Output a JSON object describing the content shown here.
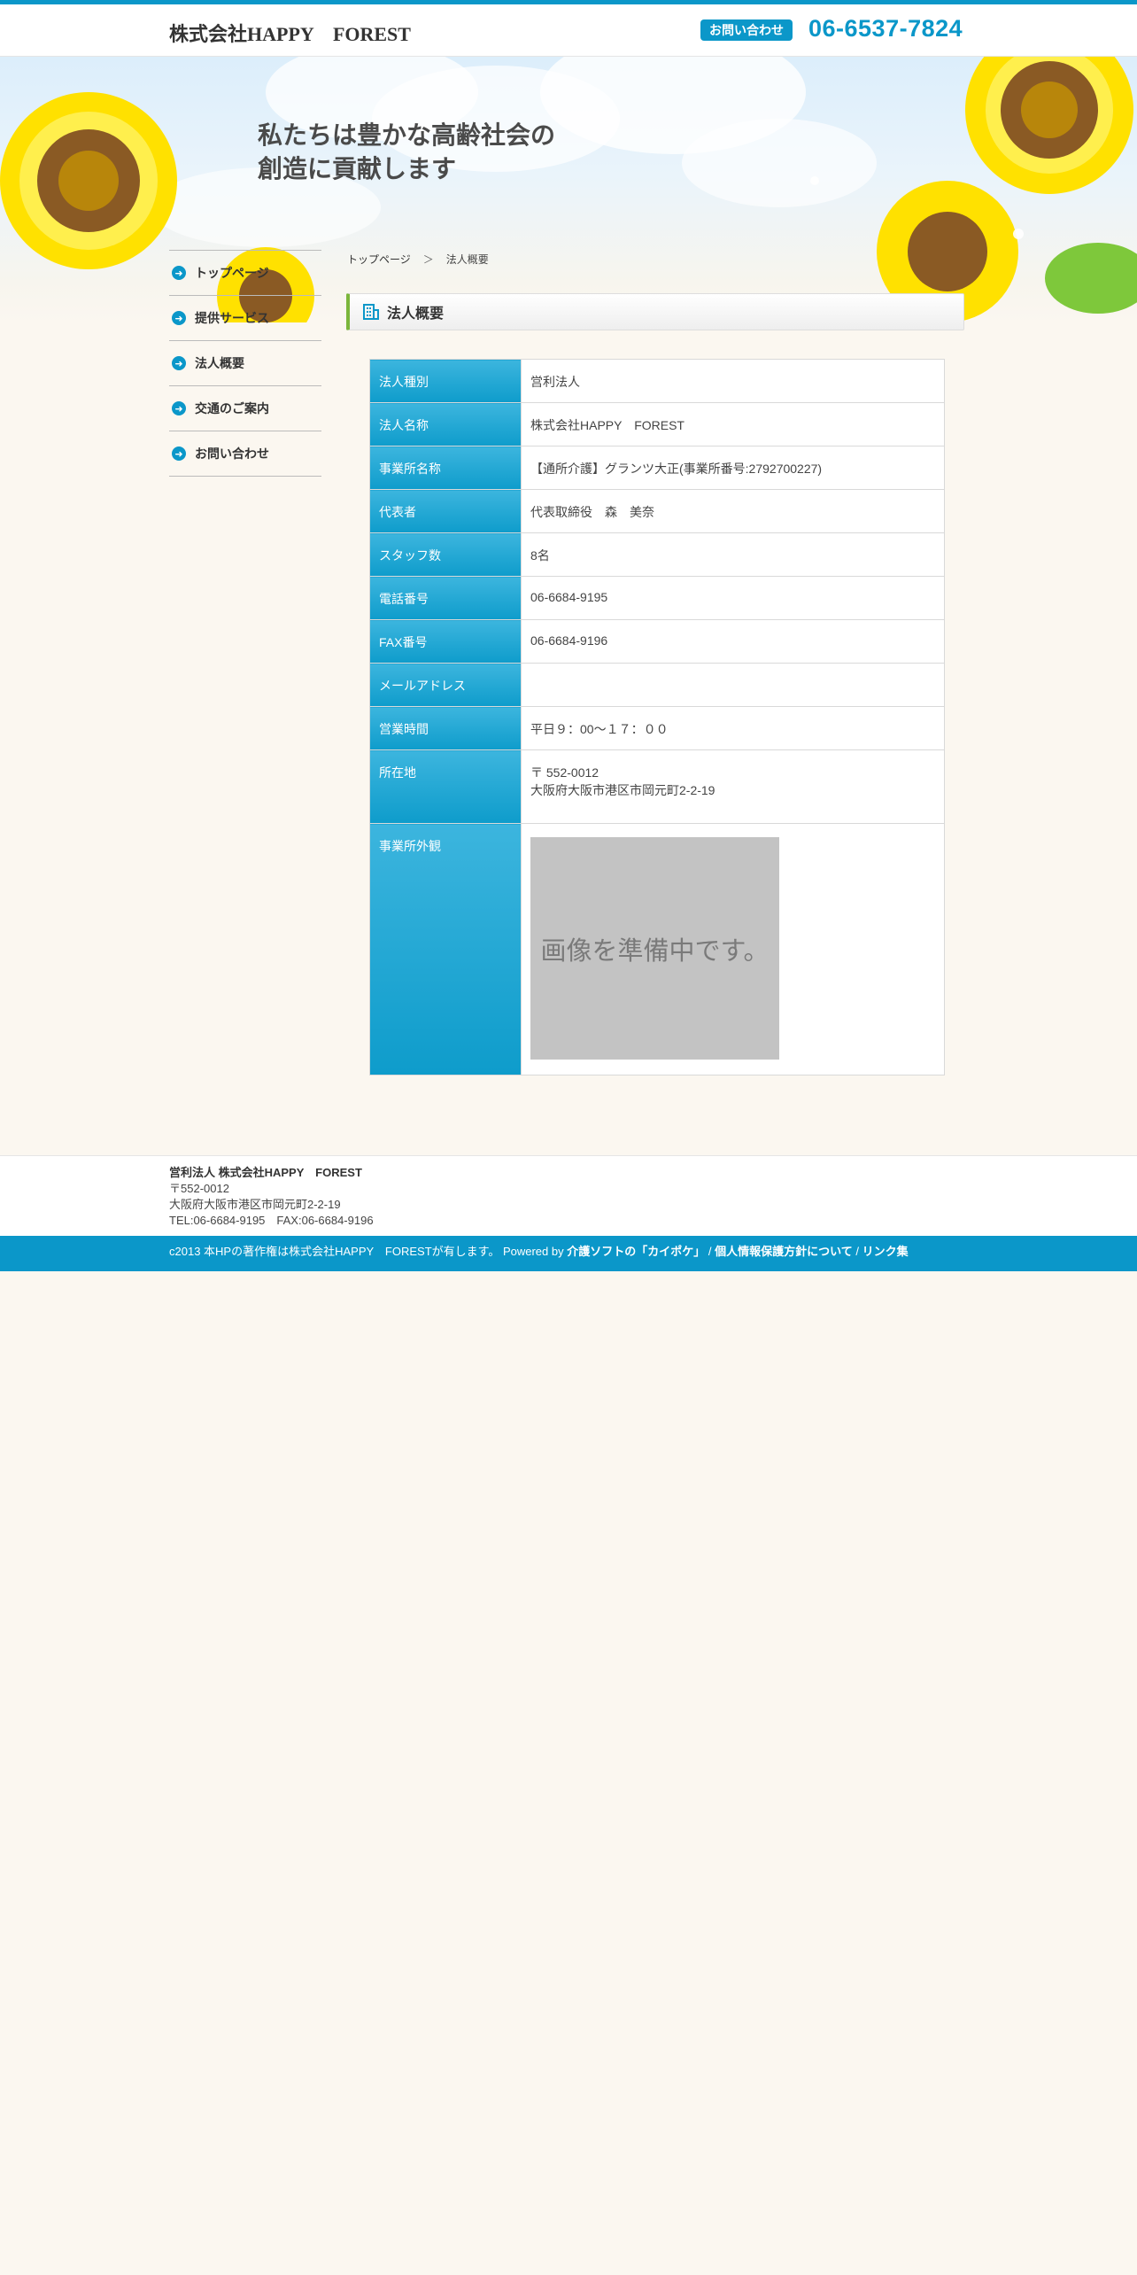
{
  "header": {
    "site_title": "株式会社HAPPY　FOREST",
    "contact_label": "お問い合わせ",
    "phone": "06-6537-7824"
  },
  "hero": {
    "catchphrase": "私たちは豊かな高齢社会の\n創造に貢献します"
  },
  "breadcrumb": {
    "home": "トップページ",
    "separator": "＞",
    "current": "法人概要"
  },
  "sidebar": {
    "items": [
      {
        "label": "トップページ",
        "icon": "arrow-right-circle-icon"
      },
      {
        "label": "提供サービス",
        "icon": "arrow-right-circle-icon"
      },
      {
        "label": "法人概要",
        "icon": "arrow-right-circle-icon"
      },
      {
        "label": "交通のご案内",
        "icon": "arrow-right-circle-icon"
      },
      {
        "label": "お問い合わせ",
        "icon": "arrow-right-circle-icon"
      }
    ]
  },
  "section": {
    "title": "法人概要",
    "icon": "building-icon"
  },
  "overview": {
    "rows": [
      {
        "label": "法人種別",
        "value": "営利法人"
      },
      {
        "label": "法人名称",
        "value": "株式会社HAPPY　FOREST"
      },
      {
        "label": "事業所名称",
        "value": "【通所介護】グランツ大正(事業所番号:2792700227)"
      },
      {
        "label": "代表者",
        "value": "代表取締役　森　美奈"
      },
      {
        "label": "スタッフ数",
        "value": "8名"
      },
      {
        "label": "電話番号",
        "value": "06-6684-9195"
      },
      {
        "label": "FAX番号",
        "value": "06-6684-9196"
      },
      {
        "label": "メールアドレス",
        "value": ""
      },
      {
        "label": "営業時間",
        "value": "平日９：00～１７：００"
      },
      {
        "label": "所在地",
        "value_line1": "〒 552-0012",
        "value_line2": "大阪府大阪市港区市岡元町2-2-19"
      },
      {
        "label": "事業所外観",
        "image_text": "画像を準備中です。"
      }
    ]
  },
  "footer": {
    "name": "営利法人 株式会社HAPPY　FOREST",
    "postal": "〒552-0012",
    "address": "大阪府大阪市港区市岡元町2-2-19",
    "tel_fax": "TEL:06-6684-9195　FAX:06-6684-9196",
    "copyright": "c2013 本HPの著作権は株式会社HAPPY　FORESTが有します。 Powered by",
    "link_kaipoke": "介護ソフトの「カイポケ」",
    "divider": "/",
    "link_privacy": "個人情報保護方針について",
    "link_links": "リンク集"
  },
  "colors": {
    "accent": "#0b97c9",
    "section_marker": "#7bb63b",
    "background": "#fbf7f0"
  }
}
